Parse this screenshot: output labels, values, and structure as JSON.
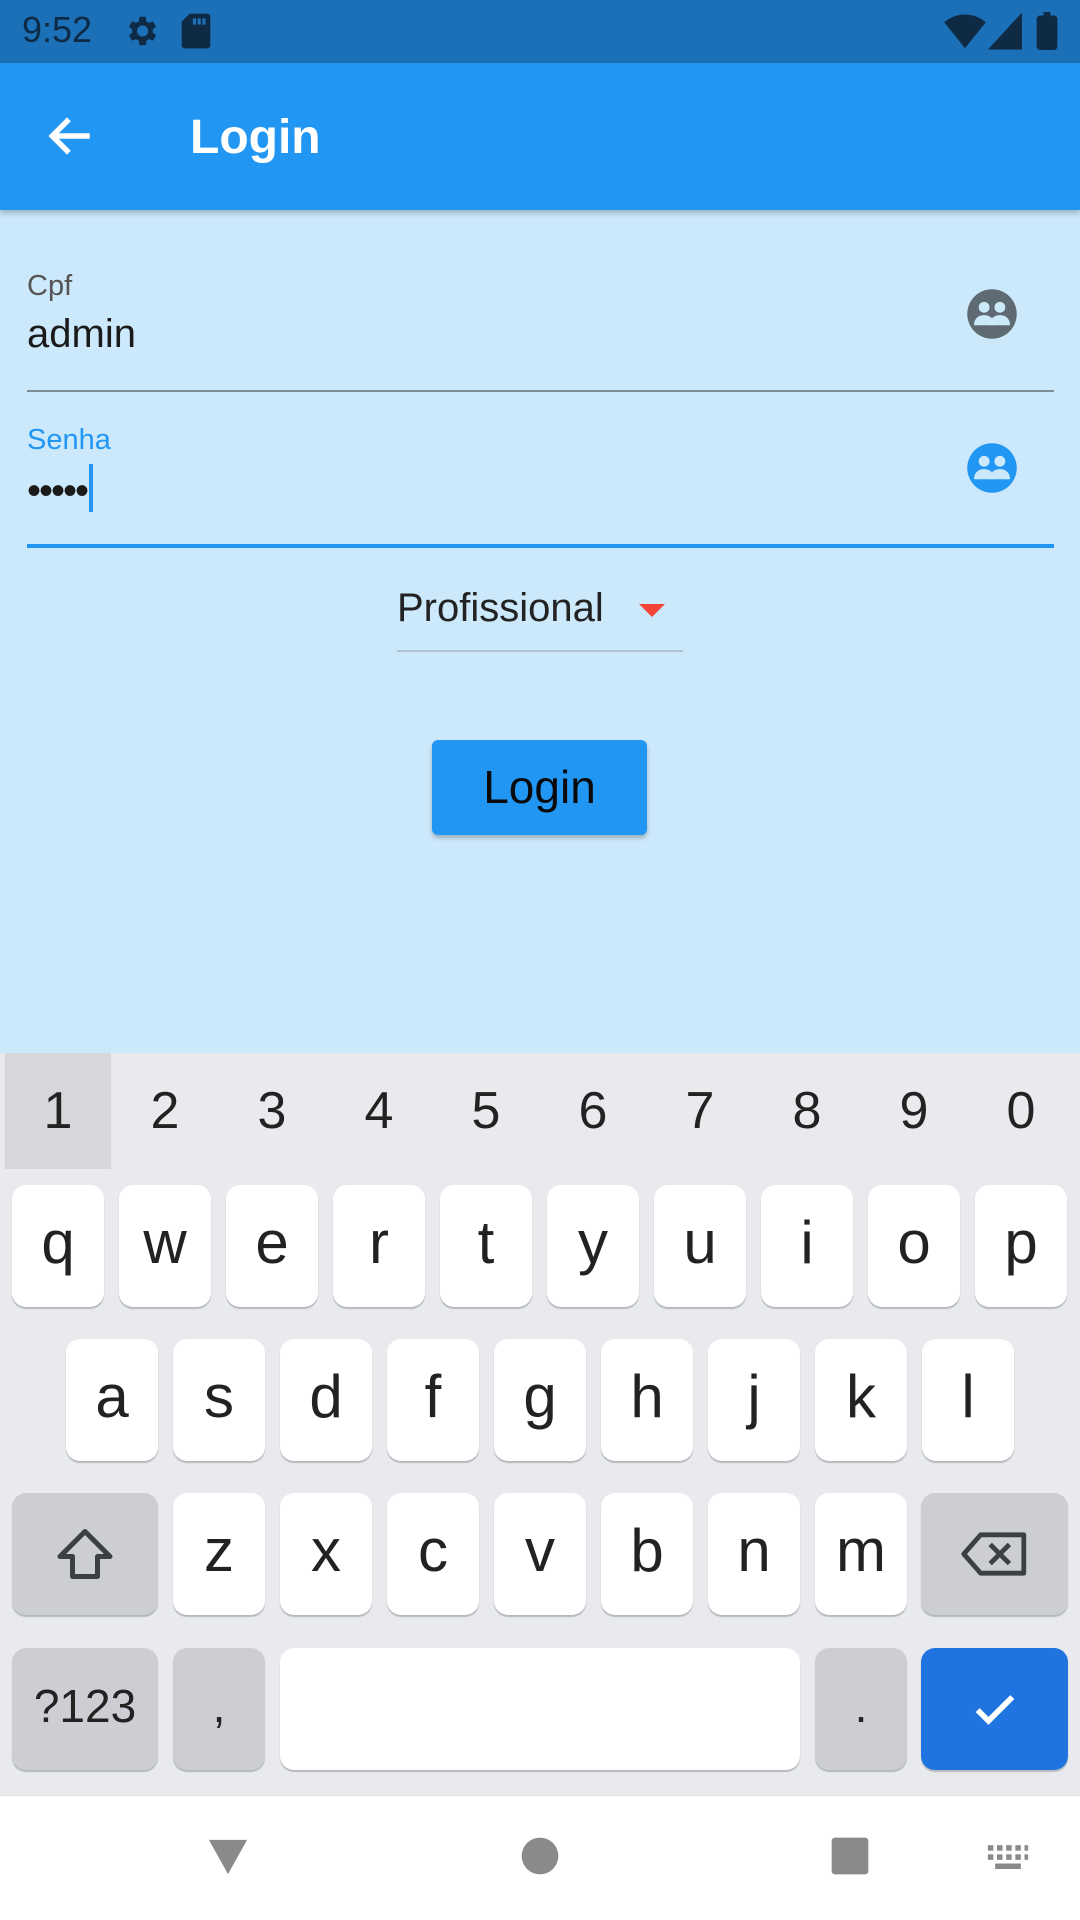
{
  "status_bar": {
    "time": "9:52",
    "icons": [
      "gear-icon",
      "sd-card-icon",
      "wifi-icon",
      "signal-icon",
      "battery-icon"
    ]
  },
  "app_bar": {
    "title": "Login",
    "back_icon": "arrow-back-icon"
  },
  "form": {
    "cpf": {
      "label": "Cpf",
      "value": "admin",
      "icon": "people-icon"
    },
    "senha": {
      "label": "Senha",
      "value": "•••••",
      "icon": "people-icon"
    },
    "profile_select": {
      "selected": "Profissional"
    },
    "login_button": {
      "label": "Login"
    }
  },
  "keyboard": {
    "number_row": [
      "1",
      "2",
      "3",
      "4",
      "5",
      "6",
      "7",
      "8",
      "9",
      "0"
    ],
    "row1": [
      "q",
      "w",
      "e",
      "r",
      "t",
      "y",
      "u",
      "i",
      "o",
      "p"
    ],
    "row2": [
      "a",
      "s",
      "d",
      "f",
      "g",
      "h",
      "j",
      "k",
      "l"
    ],
    "row3": [
      "z",
      "x",
      "c",
      "v",
      "b",
      "n",
      "m"
    ],
    "symbols_label": "?123",
    "comma_label": ",",
    "period_label": ".",
    "icons": [
      "shift-icon",
      "backspace-icon",
      "check-icon"
    ]
  },
  "nav_bar": {
    "icons": [
      "back-triangle-icon",
      "home-circle-icon",
      "recents-square-icon",
      "keyboard-switch-icon"
    ]
  },
  "colors": {
    "primary": "#2196f3",
    "status_bar": "#1b70b8",
    "background": "#cce9fb",
    "dropdown_arrow": "#f44336",
    "keyboard_action": "#1f74e0"
  }
}
